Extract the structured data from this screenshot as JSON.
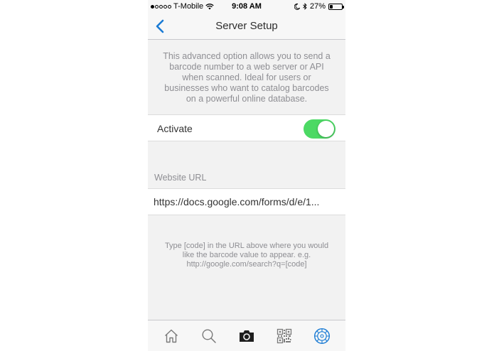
{
  "status_bar": {
    "carrier": "T-Mobile",
    "time": "9:08 AM",
    "battery": "27%",
    "battery_level": 0.27,
    "icons": [
      "signal-dots-icon",
      "wifi-icon",
      "moon-icon",
      "bluetooth-icon",
      "battery-icon"
    ]
  },
  "nav": {
    "title": "Server Setup",
    "back_icon": "chevron-left-icon"
  },
  "description": "This advanced option allows you to send a barcode number to a web server or API when scanned. Ideal for users or businesses who want to catalog barcodes on a powerful online database.",
  "activate": {
    "label": "Activate",
    "enabled": true
  },
  "website_url": {
    "header": "Website URL",
    "value": "https://docs.google.com/forms/d/e/1..."
  },
  "help_text": "Type [code] in the URL above where you would like the barcode value to appear. e.g. http://google.com/search?q=[code]",
  "tabs": [
    {
      "icon": "home-icon",
      "active": false
    },
    {
      "icon": "search-icon",
      "active": false
    },
    {
      "icon": "camera-icon",
      "active": false
    },
    {
      "icon": "qr-code-icon",
      "active": false
    },
    {
      "icon": "settings-icon",
      "active": true
    }
  ],
  "colors": {
    "accent": "#1a7bd4",
    "toggle_on": "#4cd964",
    "background": "#f2f2f2"
  }
}
